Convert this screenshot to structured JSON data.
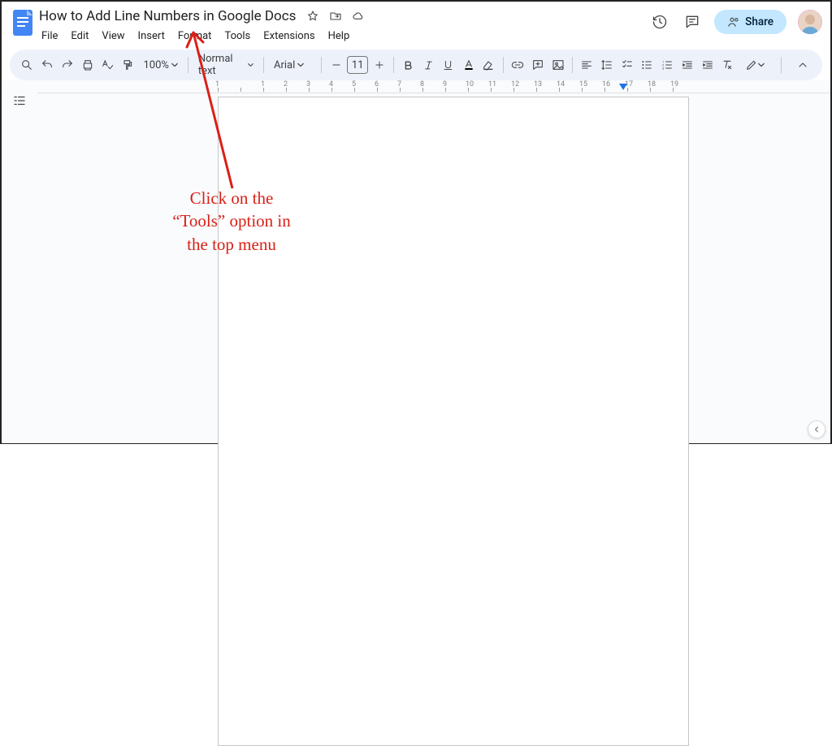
{
  "doc": {
    "title": "How to Add Line Numbers in Google Docs"
  },
  "menu": {
    "items": [
      "File",
      "Edit",
      "View",
      "Insert",
      "Format",
      "Tools",
      "Extensions",
      "Help"
    ]
  },
  "header": {
    "share_label": "Share"
  },
  "toolbar": {
    "zoom": "100%",
    "style_label": "Normal text",
    "font_label": "Arial",
    "font_size": "11"
  },
  "ruler": {
    "labels": [
      "1",
      "",
      "1",
      "2",
      "3",
      "4",
      "5",
      "6",
      "7",
      "8",
      "9",
      "10",
      "11",
      "12",
      "13",
      "14",
      "15",
      "16",
      "17",
      "18",
      "19"
    ]
  },
  "annotation": {
    "line1": "Click on the",
    "line2": "“Tools” option in",
    "line3": "the top menu"
  }
}
